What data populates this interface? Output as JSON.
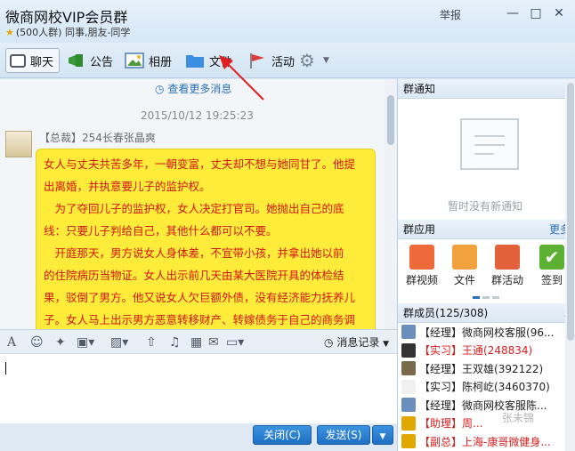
{
  "header": {
    "title": "微商网校VIP会员群",
    "group_count": "(500人群)",
    "group_tags": "同事,朋友-同学",
    "report_label": "举报"
  },
  "toolbar": {
    "chat_label": "聊天",
    "notice_label": "公告",
    "album_label": "相册",
    "files_label": "文件",
    "activity_label": "活动"
  },
  "chat": {
    "more_messages": "查看更多消息",
    "timestamp": "2015/10/12 19:25:23",
    "sender": "【总裁】254长春张晶爽",
    "message_lines": [
      "女人与丈夫共苦多年，一朝变富，丈夫却不想与她同甘了。他提",
      "出离婚，并执意要儿子的监护权。",
      "　为了夺回儿子的监护权，女人决定打官司。她抛出自己的底",
      "线：只要儿子判给自己，其他什么都可以不要。",
      "　开庭那天，男方说女人身体差，不宜带小孩，并拿出她以前",
      "的住院病历当物证。女人出示前几天由某大医院开具的体检结",
      "果，驳倒了男方。他又说女人欠巨额外债，没有经济能力抚养儿",
      "子。女人马上出示男方恶意转移财产、转嫁债务于自己的商务调"
    ]
  },
  "input": {
    "history_label": "消息记录",
    "close_button": "关闭(C)",
    "send_button": "发送(S)"
  },
  "right_panel": {
    "notice_title": "群通知",
    "notice_empty": "暂时没有新通知",
    "apps_title": "群应用",
    "apps_more": "更多",
    "apps": [
      {
        "label": "群视频"
      },
      {
        "label": "文件"
      },
      {
        "label": "群活动"
      },
      {
        "label": "签到"
      }
    ],
    "members_title": "群成员(125/308)",
    "members": [
      {
        "role": "【经理】",
        "name": "微商网校客服(96...",
        "color": "#6a8fbf"
      },
      {
        "role": "【实习】",
        "name": "王通(248834)",
        "color": "#333333"
      },
      {
        "role": "【经理】",
        "name": "王双雄(392122)",
        "color": "#7a6a4a"
      },
      {
        "role": "【实习】",
        "name": "陈柯屹(3460370)",
        "color": "#f0f0f0"
      },
      {
        "role": "【经理】",
        "name": "微商网校客服陈...",
        "color": "#6a8fbf"
      },
      {
        "role": "【助理】",
        "name": "周...",
        "color": "#e0a800"
      },
      {
        "role": "【副总】",
        "name": "上海-康哥微健身...",
        "color": "#e0a800"
      }
    ],
    "watermark": "张未锦"
  }
}
